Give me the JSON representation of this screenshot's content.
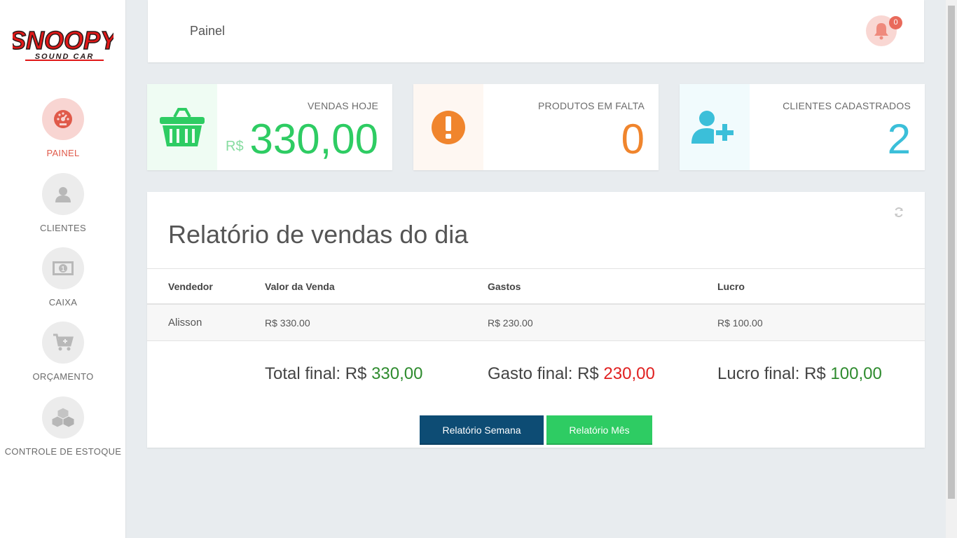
{
  "sidebar": {
    "logo": {
      "line1": "SNOOPY",
      "line2": "SOUND CAR"
    },
    "items": [
      {
        "label": "PAINEL",
        "icon": "speedometer-icon"
      },
      {
        "label": "CLIENTES",
        "icon": "user-icon"
      },
      {
        "label": "CAIXA",
        "icon": "cash-icon"
      },
      {
        "label": "ORÇAMENTO",
        "icon": "cart-add-icon"
      },
      {
        "label": "CONTROLE DE ESTOQUE",
        "icon": "boxes-icon"
      }
    ]
  },
  "header": {
    "title": "Painel",
    "notifications_count": "0"
  },
  "stats": [
    {
      "label": "VENDAS HOJE",
      "currency": "R$",
      "value": "330,00",
      "color": "#2ecc63",
      "icon": "basket-icon"
    },
    {
      "label": "PRODUTOS EM FALTA",
      "value": "0",
      "color": "#f0852d",
      "icon": "exclamation-icon"
    },
    {
      "label": "CLIENTES CADASTRADOS",
      "value": "2",
      "color": "#3bbfd9",
      "icon": "user-plus-icon"
    }
  ],
  "report": {
    "title": "Relatório de vendas do dia",
    "columns": [
      "Vendedor",
      "Valor da Venda",
      "Gastos",
      "Lucro"
    ],
    "rows": [
      {
        "vendedor": "Alisson",
        "valor": "R$ 330.00",
        "gastos": "R$ 230.00",
        "lucro": "R$ 100.00"
      }
    ],
    "totals": {
      "total_label": "Total final: R$",
      "total_value": "330,00",
      "gasto_label": "Gasto final: R$",
      "gasto_value": "230,00",
      "lucro_label": "Lucro final: R$",
      "lucro_value": "100,00"
    },
    "buttons": {
      "week": "Relatório Semana",
      "month": "Relatório Mês"
    }
  }
}
